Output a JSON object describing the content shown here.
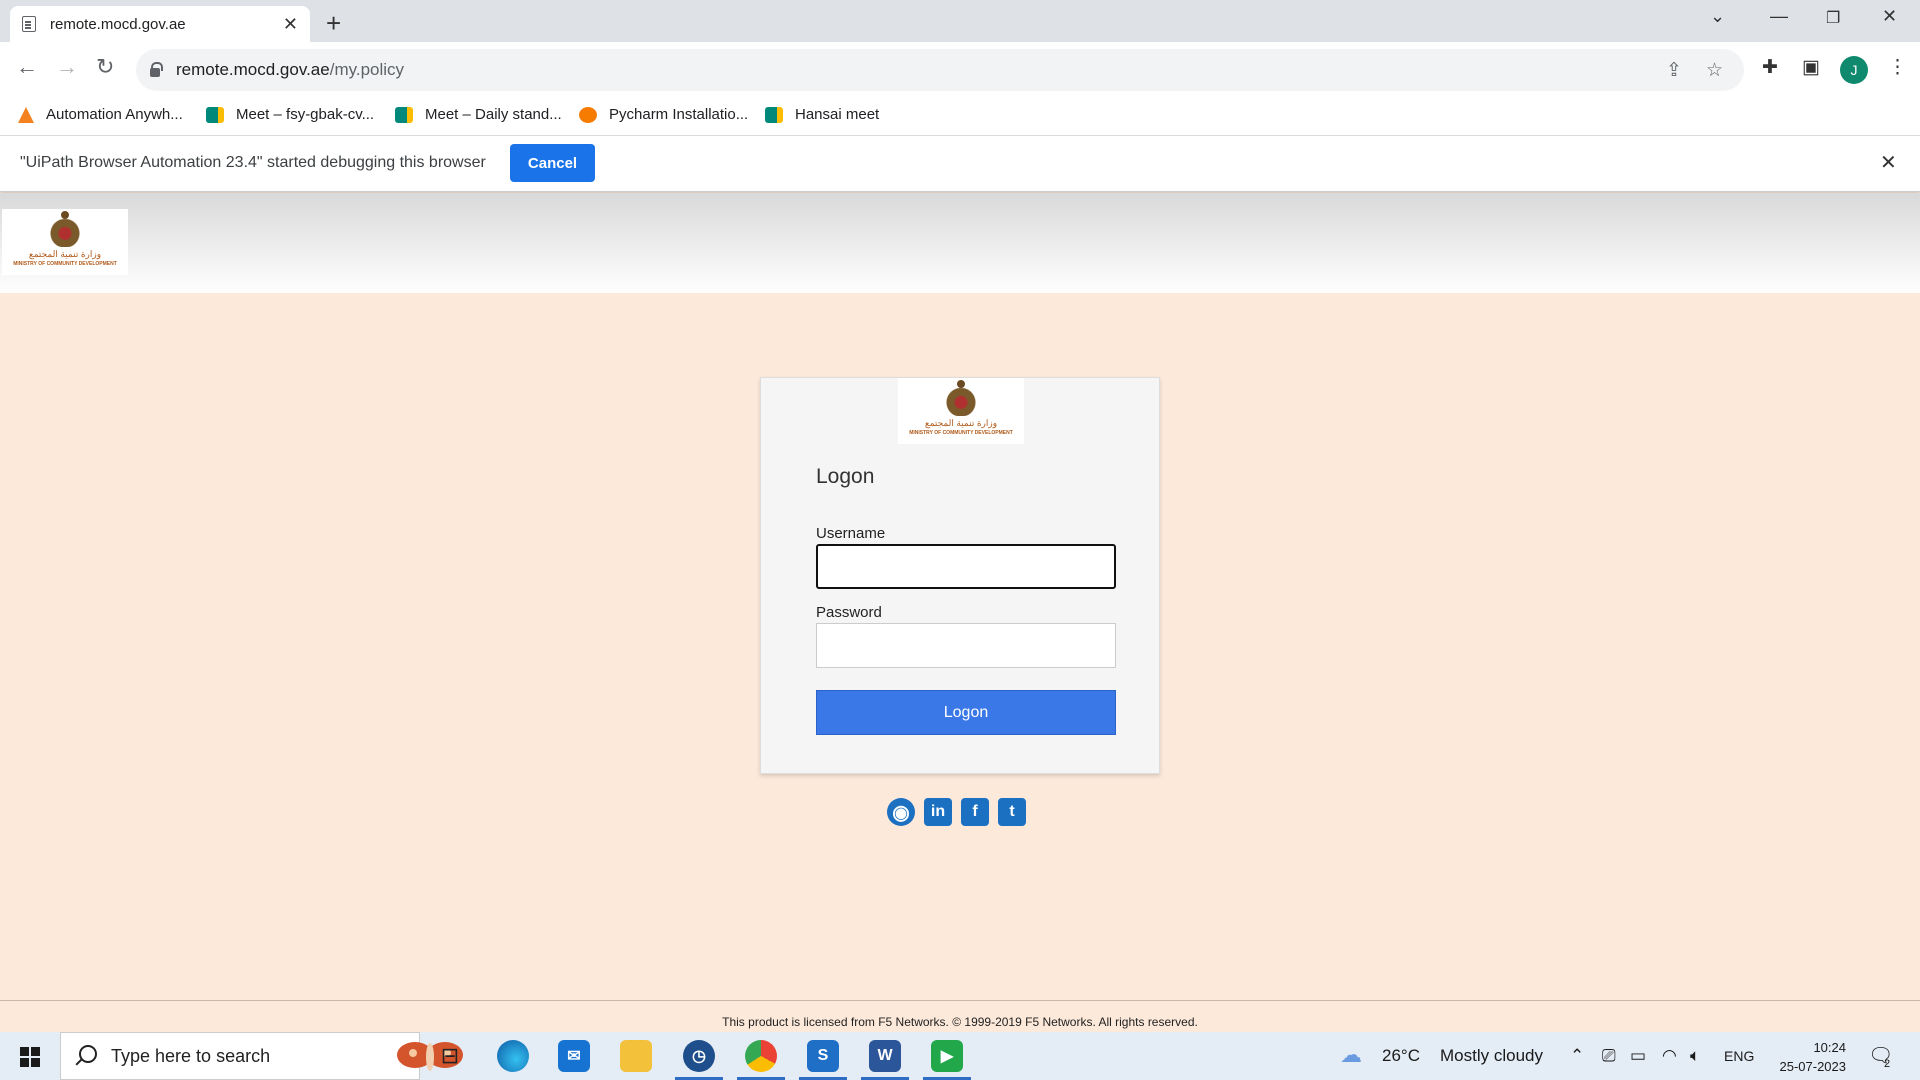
{
  "browser": {
    "tab_title": "remote.mocd.gov.ae",
    "url_domain": "remote.mocd.gov.ae",
    "url_path": "/my.policy",
    "avatar_initial": "J",
    "bookmarks": [
      {
        "label": "Automation Anywh...",
        "icon": "automation-anywhere-icon",
        "color": "#f58220"
      },
      {
        "label": "Meet – fsy-gbak-cv...",
        "icon": "google-meet-icon",
        "color": "#00897b"
      },
      {
        "label": "Meet – Daily stand...",
        "icon": "google-meet-icon",
        "color": "#00897b"
      },
      {
        "label": "Pycharm Installatio...",
        "icon": "pycharm-icon",
        "color": "#f57c00"
      },
      {
        "label": "Hansai meet",
        "icon": "google-meet-icon",
        "color": "#00897b"
      }
    ]
  },
  "infobar": {
    "message": "\"UiPath Browser Automation 23.4\" started debugging this browser",
    "cancel_label": "Cancel"
  },
  "header_logo": {
    "arabic": "وزارة تنمية المجتمع",
    "english": "MINISTRY OF COMMUNITY DEVELOPMENT"
  },
  "login": {
    "title": "Logon",
    "username_label": "Username",
    "username_value": "",
    "password_label": "Password",
    "password_value": "",
    "submit_label": "Logon"
  },
  "social_links": [
    {
      "name": "website",
      "glyph": "◉"
    },
    {
      "name": "linkedin",
      "glyph": "in"
    },
    {
      "name": "facebook",
      "glyph": "f"
    },
    {
      "name": "twitter",
      "glyph": "t"
    }
  ],
  "footer": {
    "license_text": "This product is licensed from F5 Networks. © 1999-2019 F5 Networks. All rights reserved."
  },
  "taskbar": {
    "search_placeholder": "Type here to search",
    "weather_temp": "26°C",
    "weather_desc": "Mostly cloudy",
    "language": "ENG",
    "time": "10:24",
    "date": "25-07-2023",
    "notification_count": "2"
  },
  "colors": {
    "page_bg": "#fce9da",
    "primary_button": "#3b78e7",
    "infobar_button": "#1a73e8"
  }
}
